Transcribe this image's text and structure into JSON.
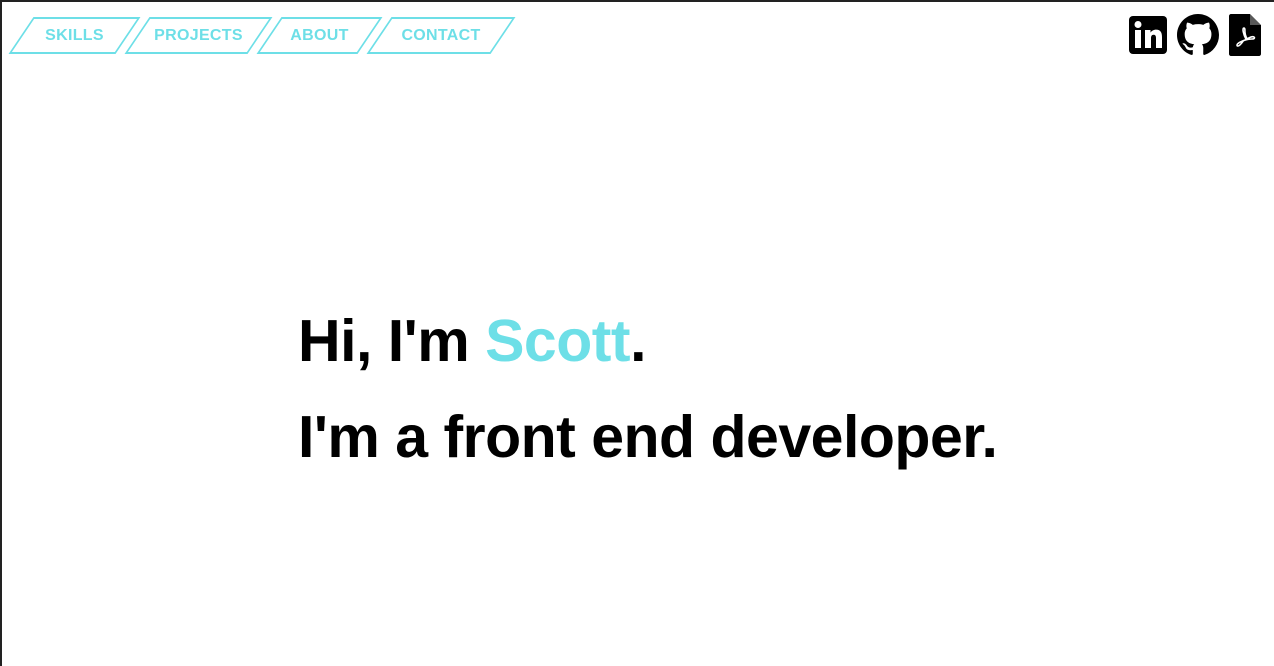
{
  "colors": {
    "accent": "#6ddfe7",
    "text": "#000000",
    "background": "#ffffff"
  },
  "nav": {
    "items": [
      {
        "label": "SKILLS"
      },
      {
        "label": "PROJECTS"
      },
      {
        "label": "ABOUT"
      },
      {
        "label": "CONTACT"
      }
    ]
  },
  "social": {
    "icons": [
      "linkedin-icon",
      "github-icon",
      "pdf-resume-icon"
    ]
  },
  "hero": {
    "greeting_prefix": "Hi, I'm ",
    "name": "Scott",
    "greeting_suffix": ".",
    "tagline": "I'm a front end developer."
  }
}
